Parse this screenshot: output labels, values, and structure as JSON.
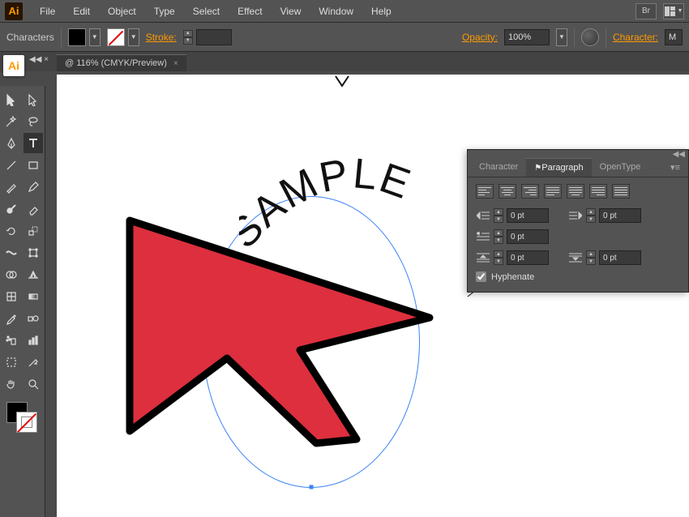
{
  "menubar": {
    "items": [
      "File",
      "Edit",
      "Object",
      "Type",
      "Select",
      "Effect",
      "View",
      "Window",
      "Help"
    ]
  },
  "optionsbar": {
    "left_label": "Characters",
    "stroke_label": "Stroke:",
    "opacity_label": "Opacity:",
    "opacity_value": "100%",
    "character_label": "Character:",
    "char_value": "M"
  },
  "document": {
    "tab_title": "@ 116% (CMYK/Preview)",
    "ai_badge": "Ai",
    "handle": "◀◀ ×"
  },
  "canvas": {
    "sample_text": "SAMPLE"
  },
  "panel": {
    "tabs": [
      "Character",
      "Paragraph",
      "OpenType"
    ],
    "indent_values": [
      "0 pt",
      "0 pt",
      "0 pt",
      "0 pt",
      "0 pt"
    ],
    "hyphenate_label": "Hyphenate",
    "hyphenate_checked": true,
    "menu_glyph": "▾≡"
  },
  "tools": {
    "names": [
      [
        "selection-tool",
        "direct-selection-tool"
      ],
      [
        "magic-wand-tool",
        "lasso-tool"
      ],
      [
        "pen-tool",
        "type-tool"
      ],
      [
        "line-segment-tool",
        "rectangle-tool"
      ],
      [
        "paintbrush-tool",
        "pencil-tool"
      ],
      [
        "blob-brush-tool",
        "eraser-tool"
      ],
      [
        "rotate-tool",
        "scale-tool"
      ],
      [
        "width-tool",
        "free-transform-tool"
      ],
      [
        "shape-builder-tool",
        "perspective-grid-tool"
      ],
      [
        "mesh-tool",
        "gradient-tool"
      ],
      [
        "eyedropper-tool",
        "blend-tool"
      ],
      [
        "symbol-sprayer-tool",
        "column-graph-tool"
      ],
      [
        "artboard-tool",
        "slice-tool"
      ],
      [
        "hand-tool",
        "zoom-tool"
      ]
    ]
  }
}
